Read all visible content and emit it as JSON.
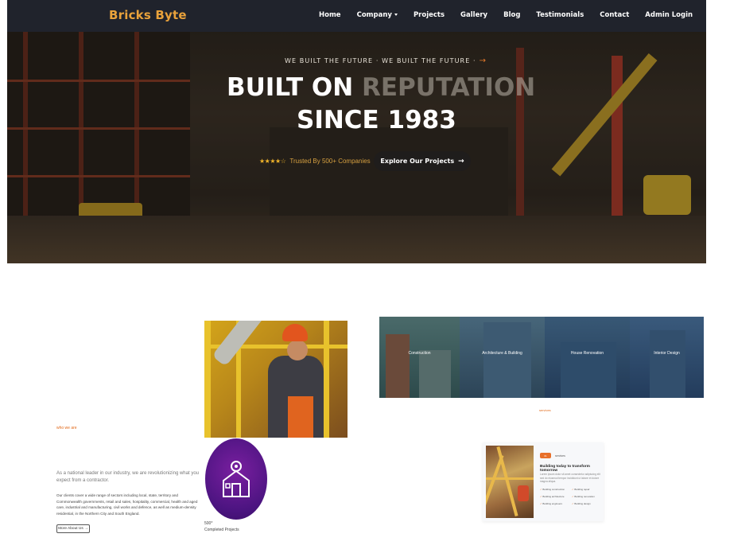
{
  "nav": {
    "brand": "Bricks Byte",
    "links": [
      "Home",
      "Company",
      "Projects",
      "Gallery",
      "Blog",
      "Testimonials",
      "Contact",
      "Admin Login"
    ]
  },
  "hero": {
    "tagline": "WE BUILT THE FUTURE · WE BUILT THE FUTURE ·",
    "headline_part1": "BUILT ON ",
    "headline_part2": "REPUTATION",
    "headline_line2": "SINCE 1983",
    "stars": "★★★★☆",
    "rating_text": "Trusted By 500+ Companies",
    "cta_label": "Explore Our Projects"
  },
  "about": {
    "label": "who we are",
    "lead": "As a national leader in our industry, we are revolutionizing what you expect from a contractor.",
    "paragraph": "Our clients cover a wide range of sectors including local, state, territory and Commonwealth governments, retail and sales, hospitality, commercial, health and aged care, industrial and manufacturing, civil works and defence, as well as medium-density residential, in the Northern City and South England.",
    "more_button": "More About Us →",
    "stat_number": "500*",
    "stat_label": "Completed Projects"
  },
  "services": {
    "items": [
      "Construction",
      "Architecture & Building",
      "House Renovation",
      "Interior Design"
    ],
    "caption": "services"
  },
  "card": {
    "pill": "01",
    "tag": "services",
    "title": "Building today to transform tomorrow",
    "text": "Lorem ipsum dolor sit amet consectetur adipiscing elit sed do eiusmod tempor incididunt ut labore et dolore magna aliqua.",
    "list": [
      "Building construction",
      "Building repair",
      "Building architecture",
      "Building renovation",
      "Building engineers",
      "Building design"
    ]
  },
  "colors": {
    "accent": "#e9a23b",
    "orange": "#e26b1c",
    "nav_bg": "#20232c",
    "badge_purple": "#5a1890"
  }
}
